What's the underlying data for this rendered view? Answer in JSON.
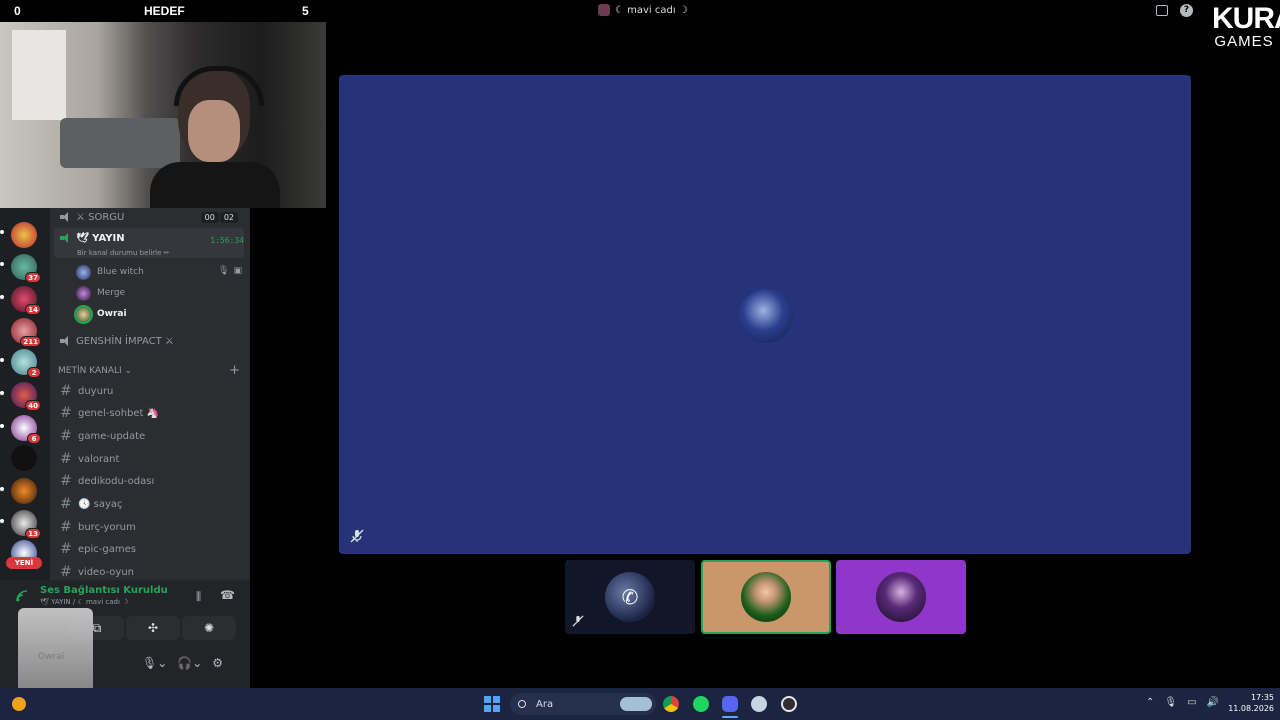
{
  "overlay": {
    "score_left": "0",
    "goal_label": "HEDEF",
    "score_right": "5",
    "call_title": "☾ mavi cadı ☽",
    "logo_line1": "KURA",
    "logo_line2": "GAMES"
  },
  "server_badges": [
    "37",
    "14",
    "211",
    "2",
    "40",
    "6",
    "13"
  ],
  "new_badge": "YENİ",
  "voice_channels": {
    "sorgu": {
      "name": "⚔ SORGU",
      "counts": [
        "00",
        "02"
      ]
    },
    "yayin": {
      "name": "🕊 YAYIN",
      "status": "Bir kanal durumu belirle ✏",
      "time": "1:56:34"
    },
    "genshin": {
      "name": "GENSHİN İMPACT ⚔"
    }
  },
  "members": [
    "Blue witch",
    "Merge",
    "Owrai"
  ],
  "text_category": {
    "name": "METİN KANALI ⌄",
    "add": "+"
  },
  "text_channels": [
    "duyuru",
    "genel-sohbet 🦄",
    "game-update",
    "valorant",
    "dedikodu-odası",
    "🕓 sayaç",
    "burç-yorum",
    "epic-games",
    "video-oyun"
  ],
  "voice_panel": {
    "status": "Ses Bağlantısı Kuruldu",
    "sub": "🕊 YAYIN / ☾ mavi cadı ☽",
    "username": "Owrai"
  },
  "taskbar": {
    "search_placeholder": "Ara",
    "time": "17:35",
    "date": "11.08.2026"
  },
  "colors": {
    "stage": "#26337a",
    "discord_green": "#23a55a",
    "taskbar": "#1b2440"
  }
}
